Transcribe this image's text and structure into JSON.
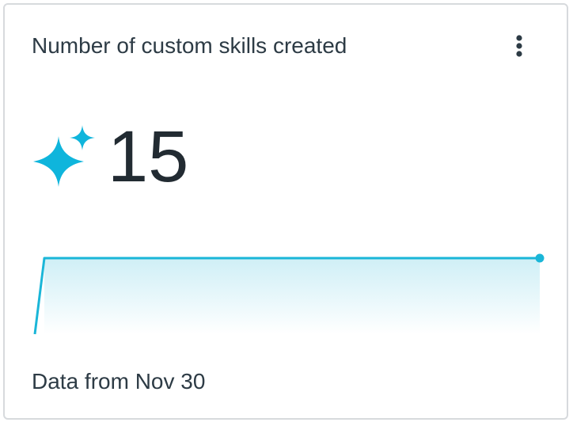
{
  "card": {
    "title": "Number of custom skills created",
    "menu_icon": "vertical-ellipsis-icon",
    "metric": {
      "icon": "sparkle-icon",
      "value": "15"
    },
    "footer": "Data from Nov 30"
  },
  "chart_data": {
    "type": "area",
    "series": [
      {
        "values": [
          0,
          15,
          15
        ]
      }
    ],
    "ylim": [
      0,
      15
    ],
    "grid": false,
    "line_color": "#1ab6d8",
    "fill_color_top": "#cfeff6",
    "fill_color_bottom": "#ffffff"
  },
  "colors": {
    "accent": "#0fb5dc",
    "border": "#d7dadd",
    "text": "#2d3b45"
  }
}
